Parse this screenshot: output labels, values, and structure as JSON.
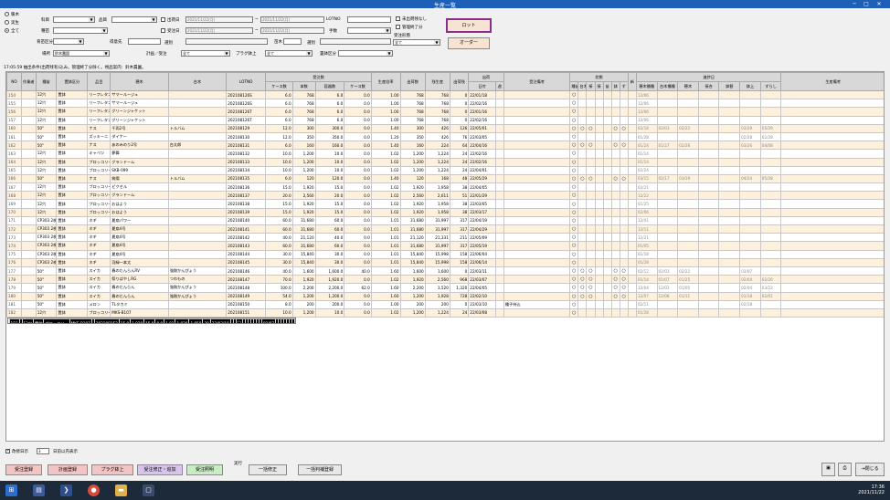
{
  "window": {
    "title": "生産一覧",
    "minimize": "─",
    "maximize": "□",
    "close": "✕"
  },
  "filters": {
    "radio_options": [
      "暖木",
      "実生",
      "全て"
    ],
    "item_label": "科目",
    "product_label": "品目",
    "shipdate_label": "出荷日",
    "shipdate_from": "2021/11/22(月)",
    "shipdate_to": "2021/11/22(月)",
    "lotno_label": "LOTNO",
    "seed_label": "種苗",
    "orderdate_label": "受注日",
    "orderdate_from": "2021/11/22(月)",
    "orderdate_to": "2021/11/22(月)",
    "stock_label": "手数",
    "type_label": "育苗区分",
    "customer_label": "得意先",
    "place_label": "場所",
    "place_value": "鈴木農園",
    "seedling_label": "苗木",
    "select_label": "選別",
    "variety_label": "穂木",
    "rootstock_label": "台木",
    "plan_label": "計画／受注",
    "plan_value": "全て",
    "plug_label": "プラグ鉢上",
    "plug_value": "全て",
    "pot_label": "置鉢区分",
    "unshipped_label": "未出荷残なし",
    "managed_label": "管理終了分",
    "orderform_label": "受注形態",
    "orderform_value": "全て",
    "lot_button": "ロット",
    "order_button": "オーダー",
    "hint": "17:05:59  抽出条件(出荷残有)込み。管理終了分除く。視品案内：鈴木農園。"
  },
  "table": {
    "group_headers": {
      "order": "受注数",
      "status": "状態",
      "progress": "進捗日"
    },
    "headers": [
      "NO",
      "作業者",
      "種苗",
      "置鉢区分",
      "品目",
      "穂木",
      "台木",
      "LOTNO",
      "ケース数",
      "本数",
      "容器数",
      "ケース数",
      "生産倍率",
      "出荷数",
      "残生産",
      "出荷残",
      "日付",
      "週",
      "受注備考",
      "種",
      "台",
      "接",
      "接",
      "苗",
      "鉢",
      "ず",
      "新",
      "穂木",
      "台木",
      "穂木",
      "接合",
      "鉢替",
      "鉢上",
      "ずらし",
      "生産備考"
    ],
    "ship_header": "出荷",
    "status_sub": [
      "種苗",
      "台木",
      "接",
      "接",
      "苗",
      "鉢",
      "ず"
    ],
    "progress_sub": [
      "穂木播種",
      "台木播種",
      "穂木",
      "接合",
      "鉢替",
      "鉢上",
      "ずらし"
    ],
    "rows": [
      [
        "154",
        "",
        "12穴",
        "置鉢",
        "リーフレタス",
        "サマールージュ",
        "",
        "202108126S",
        "6.0",
        "768",
        "6.0",
        "0.0",
        "1.00",
        "768",
        "768",
        "0",
        "22/01/18",
        "",
        "",
        "○",
        "",
        "",
        "",
        "",
        "",
        "",
        "",
        "12/06",
        "",
        "",
        "",
        "",
        "",
        "",
        ""
      ],
      [
        "155",
        "",
        "12穴",
        "置鉢",
        "リーフレタス",
        "サマールージュ",
        "",
        "202108126S",
        "6.0",
        "768",
        "6.0",
        "0.0",
        "1.00",
        "768",
        "768",
        "0",
        "22/02/16",
        "",
        "",
        "○",
        "",
        "",
        "",
        "",
        "",
        "",
        "",
        "12/06",
        "",
        "",
        "",
        "",
        "",
        "",
        ""
      ],
      [
        "156",
        "",
        "12穴",
        "置鉢",
        "リーフレタス",
        "グリーンジャケット",
        "",
        "202108126T",
        "6.0",
        "768",
        "6.0",
        "0.0",
        "1.00",
        "768",
        "768",
        "0",
        "22/01/16",
        "",
        "",
        "○",
        "",
        "",
        "",
        "",
        "",
        "",
        "",
        "12/06",
        "",
        "",
        "",
        "",
        "",
        "",
        ""
      ],
      [
        "157",
        "",
        "12穴",
        "置鉢",
        "リーフレタス",
        "グリーンジャケット",
        "",
        "202108126T",
        "6.0",
        "768",
        "6.0",
        "0.0",
        "1.00",
        "768",
        "768",
        "0",
        "22/02/16",
        "",
        "",
        "○",
        "",
        "",
        "",
        "",
        "",
        "",
        "",
        "12/06",
        "",
        "",
        "",
        "",
        "",
        "",
        ""
      ],
      [
        "160",
        "",
        "50\"",
        "置鉢",
        "ナス",
        "千両2号",
        "トルバム",
        "202108129",
        "12.0",
        "300",
        "300.0",
        "0.0",
        "1.40",
        "300",
        "426",
        "126",
        "22/05/01",
        "",
        "",
        "○",
        "○",
        "○",
        "",
        "",
        "○",
        "○",
        "",
        "02/18",
        "02/03",
        "02/22",
        "",
        "",
        "03/29",
        "05/29",
        ""
      ],
      [
        "161",
        "",
        "50\"",
        "置鉢",
        "ズッキーニ",
        "ダイナー",
        "",
        "202108130",
        "12.0",
        "350",
        "350.0",
        "0.0",
        "1.20",
        "350",
        "426",
        "76",
        "22/03/05",
        "",
        "",
        "○",
        "",
        "",
        "",
        "",
        "",
        "",
        "",
        "01/28",
        "",
        "",
        "",
        "",
        "02/28",
        "02/28",
        ""
      ],
      [
        "162",
        "",
        "50\"",
        "置鉢",
        "ナス",
        "あのみのり2号",
        "台太郎",
        "202108131",
        "6.0",
        "160",
        "160.0",
        "0.0",
        "1.40",
        "160",
        "224",
        "64",
        "22/04/16",
        "",
        "",
        "○",
        "○",
        "○",
        "",
        "",
        "○",
        "○",
        "",
        "01/24",
        "01/27",
        "02/26",
        "",
        "",
        "03/26",
        "04/08",
        ""
      ],
      [
        "163",
        "",
        "12穴",
        "置鉢",
        "キャベツ",
        "夢舞",
        "",
        "202108132",
        "10.0",
        "1,200",
        "10.0",
        "0.0",
        "1.02",
        "1,200",
        "1,224",
        "24",
        "22/02/16",
        "",
        "",
        "○",
        "",
        "",
        "",
        "",
        "",
        "",
        "",
        "01/14",
        "",
        "",
        "",
        "",
        "",
        "",
        ""
      ],
      [
        "164",
        "",
        "12穴",
        "置鉢",
        "ブロッコリー",
        "グランドーム",
        "",
        "202108133",
        "10.0",
        "1,200",
        "10.0",
        "0.0",
        "1.02",
        "1,200",
        "1,224",
        "24",
        "22/02/16",
        "",
        "",
        "○",
        "",
        "",
        "",
        "",
        "",
        "",
        "",
        "01/14",
        "",
        "",
        "",
        "",
        "",
        "",
        ""
      ],
      [
        "165",
        "",
        "12穴",
        "置鉢",
        "ブロッコリー",
        "SKB-099",
        "",
        "202108134",
        "10.0",
        "1,200",
        "10.0",
        "0.0",
        "1.02",
        "1,200",
        "1,224",
        "24",
        "22/04/01",
        "",
        "",
        "○",
        "",
        "",
        "",
        "",
        "",
        "",
        "",
        "02/24",
        "",
        "",
        "",
        "",
        "",
        "",
        ""
      ],
      [
        "166",
        "",
        "50\"",
        "置鉢",
        "ナス",
        "筑陽",
        "トルバム",
        "202108135",
        "6.0",
        "120",
        "120.0",
        "0.0",
        "1.40",
        "120",
        "168",
        "48",
        "22/05/29",
        "",
        "",
        "○",
        "○",
        "○",
        "",
        "",
        "○",
        "○",
        "",
        "03/15",
        "02/17",
        "03/19",
        "",
        "",
        "04/24",
        "05/28",
        ""
      ],
      [
        "167",
        "",
        "12穴",
        "置鉢",
        "ブロッコリー",
        "ピクセル",
        "",
        "202108136",
        "15.0",
        "1,920",
        "15.0",
        "0.0",
        "1.02",
        "1,920",
        "1,958",
        "38",
        "22/04/05",
        "",
        "",
        "○",
        "",
        "",
        "",
        "",
        "",
        "",
        "",
        "02/21",
        "",
        "",
        "",
        "",
        "",
        "",
        ""
      ],
      [
        "168",
        "",
        "12穴",
        "置鉢",
        "ブロッコリー",
        "グランドーム",
        "",
        "202108137",
        "20.0",
        "2,560",
        "20.0",
        "0.0",
        "1.02",
        "2,560",
        "2,611",
        "51",
        "22/01/29",
        "",
        "",
        "○",
        "",
        "",
        "",
        "",
        "",
        "",
        "",
        "12/22",
        "",
        "",
        "",
        "",
        "",
        "",
        ""
      ],
      [
        "169",
        "",
        "12穴",
        "置鉢",
        "ブロッコリー",
        "おはよう",
        "",
        "202108138",
        "15.0",
        "1,920",
        "15.0",
        "0.0",
        "1.02",
        "1,920",
        "1,958",
        "38",
        "22/03/05",
        "",
        "",
        "○",
        "",
        "",
        "",
        "",
        "",
        "",
        "",
        "01/25",
        "",
        "",
        "",
        "",
        "",
        "",
        ""
      ],
      [
        "170",
        "",
        "12穴",
        "置鉢",
        "ブロッコリー",
        "おはよう",
        "",
        "202108139",
        "15.0",
        "1,920",
        "15.0",
        "0.0",
        "1.02",
        "1,920",
        "1,958",
        "38",
        "22/03/17",
        "",
        "",
        "○",
        "",
        "",
        "",
        "",
        "",
        "",
        "",
        "02/06",
        "",
        "",
        "",
        "",
        "",
        "",
        ""
      ],
      [
        "171",
        "",
        "CP303 2株",
        "置鉢",
        "ネギ",
        "夏扇パワー",
        "",
        "202108140",
        "60.0",
        "31,680",
        "60.0",
        "0.0",
        "1.01",
        "31,680",
        "31,997",
        "317",
        "22/04/19",
        "",
        "",
        "○",
        "",
        "",
        "",
        "",
        "",
        "",
        "",
        "12/01",
        "",
        "",
        "",
        "",
        "",
        "",
        ""
      ],
      [
        "172",
        "",
        "CP303 2株",
        "置鉢",
        "ネギ",
        "夏扇4号",
        "",
        "202108141",
        "60.0",
        "31,680",
        "60.0",
        "0.0",
        "1.01",
        "31,680",
        "31,997",
        "317",
        "22/04/29",
        "",
        "",
        "○",
        "",
        "",
        "",
        "",
        "",
        "",
        "",
        "12/11",
        "",
        "",
        "",
        "",
        "",
        "",
        ""
      ],
      [
        "173",
        "",
        "CP303 2株",
        "置鉢",
        "ネギ",
        "夏扇4号",
        "",
        "202108142",
        "40.0",
        "21,120",
        "40.0",
        "0.0",
        "1.01",
        "21,120",
        "21,331",
        "211",
        "22/05/09",
        "",
        "",
        "○",
        "",
        "",
        "",
        "",
        "",
        "",
        "",
        "12/21",
        "",
        "",
        "",
        "",
        "",
        "",
        ""
      ],
      [
        "174",
        "",
        "CP303 2株",
        "置鉢",
        "ネギ",
        "夏扇4号",
        "",
        "202108143",
        "60.0",
        "31,680",
        "60.0",
        "0.0",
        "1.01",
        "31,680",
        "31,997",
        "317",
        "22/05/19",
        "",
        "",
        "○",
        "",
        "",
        "",
        "",
        "",
        "",
        "",
        "01/05",
        "",
        "",
        "",
        "",
        "",
        "",
        ""
      ],
      [
        "175",
        "",
        "CP303 2株",
        "置鉢",
        "ネギ",
        "夏扇4号",
        "",
        "202108144",
        "30.0",
        "15,840",
        "30.0",
        "0.0",
        "1.01",
        "15,840",
        "15,998",
        "158",
        "22/06/04",
        "",
        "",
        "○",
        "",
        "",
        "",
        "",
        "",
        "",
        "",
        "01/18",
        "",
        "",
        "",
        "",
        "",
        "",
        ""
      ],
      [
        "176",
        "",
        "CP303 2株",
        "置鉢",
        "ネギ",
        "羽緑一本太",
        "",
        "202108145",
        "30.0",
        "15,840",
        "30.0",
        "0.0",
        "1.01",
        "15,840",
        "15,998",
        "158",
        "22/06/14",
        "",
        "",
        "○",
        "",
        "",
        "",
        "",
        "",
        "",
        "",
        "01/28",
        "",
        "",
        "",
        "",
        "",
        "",
        ""
      ],
      [
        "177",
        "",
        "50\"",
        "置鉢",
        "スイカ",
        "春のだんらんRV",
        "強剛かんぴょう",
        "202108146",
        "40.0",
        "1,600",
        "1,600.0",
        "40.0",
        "1.60",
        "1,600",
        "1,600",
        "0",
        "22/03/11",
        "",
        "",
        "○",
        "○",
        "○",
        "",
        "",
        "○",
        "○",
        "",
        "02/12",
        "02/03",
        "02/22",
        "",
        "",
        "03/07",
        "",
        ""
      ],
      [
        "178",
        "",
        "50\"",
        "置鉢",
        "スイカ",
        "祭りばやしRG",
        "つわもの",
        "202108147",
        "70.0",
        "1,920",
        "1,920.0",
        "0.0",
        "1.02",
        "1,920",
        "2,560",
        "968",
        "22/03/07",
        "",
        "",
        "○",
        "○",
        "○",
        "",
        "",
        "○",
        "○",
        "",
        "01/14",
        "01/07",
        "01/25",
        "",
        "",
        "02/04",
        "02/26",
        ""
      ],
      [
        "179",
        "",
        "50\"",
        "置鉢",
        "スイカ",
        "春のだんらん",
        "強剛かんぴょう",
        "202108148",
        "100.0",
        "2,200",
        "2,200.0",
        "62.0",
        "1.60",
        "2,200",
        "3,520",
        "1,320",
        "22/04/05",
        "",
        "",
        "○",
        "○",
        "○",
        "",
        "",
        "○",
        "○",
        "",
        "12/04",
        "12/03",
        "01/05",
        "",
        "",
        "02/04",
        "03/22",
        ""
      ],
      [
        "180",
        "",
        "50\"",
        "置鉢",
        "スイカ",
        "春のだんらん",
        "強剛かんぴょう",
        "202108149",
        "54.0",
        "1,200",
        "1,200.0",
        "0.0",
        "1.60",
        "1,200",
        "1,928",
        "728",
        "22/02/10",
        "",
        "",
        "○",
        "○",
        "○",
        "",
        "",
        "○",
        "○",
        "",
        "12/07",
        "12/08",
        "01/11",
        "",
        "",
        "01/18",
        "02/01",
        ""
      ],
      [
        "181",
        "",
        "50\"",
        "置鉢",
        "メロン",
        "TLタカミ",
        "",
        "202108150",
        "8.0",
        "200",
        "200.0",
        "0.0",
        "1.00",
        "200",
        "200",
        "0",
        "22/03/10",
        "",
        "種子持込",
        "○",
        "",
        "",
        "",
        "",
        "",
        "",
        "",
        "02/11",
        "",
        "",
        "",
        "",
        "02/18",
        "",
        ""
      ],
      [
        "182",
        "",
        "12穴",
        "置鉢",
        "ブロッコリー",
        "MKS-B107",
        "",
        "202108151",
        "10.0",
        "1,200",
        "10.0",
        "0.0",
        "1.02",
        "1,200",
        "1,224",
        "24",
        "22/03/08",
        "",
        "",
        "○",
        "",
        "",
        "",
        "",
        "",
        "",
        "",
        "01/28",
        "",
        "",
        "",
        "",
        "",
        "",
        ""
      ],
      [
        "183",
        "",
        "12穴",
        "置鉢",
        "ブロッコリー",
        "MKS-B107",
        "",
        "202108152",
        "15.0",
        "1,920",
        "15.0",
        "0.0",
        "1.02",
        "1,920",
        "1,958",
        "38",
        "22/03/18",
        "",
        "",
        "○",
        "",
        "",
        "",
        "",
        "",
        "",
        "",
        "02/07",
        "",
        "",
        "",
        "",
        "",
        "",
        ""
      ]
    ]
  },
  "bottom": {
    "check_label": "改修日示",
    "check_value": "3",
    "check_suffix": "日前以内表示",
    "buttons": [
      "受注登録",
      "計画登録",
      "プラグ鉢上",
      "受注修正・追加",
      "受注照明"
    ],
    "exec_label": "実行",
    "mid_buttons": [
      "一括修正",
      "一括判補登録"
    ],
    "close_label": "閉じる"
  },
  "taskbar": {
    "time": "17:36",
    "date": "2021/11/22"
  },
  "colors": {
    "titlebar": "#1e5fb8",
    "row_odd": "#fdf0dc",
    "selected": "#000000",
    "lot_border": "#8e2c8e"
  }
}
